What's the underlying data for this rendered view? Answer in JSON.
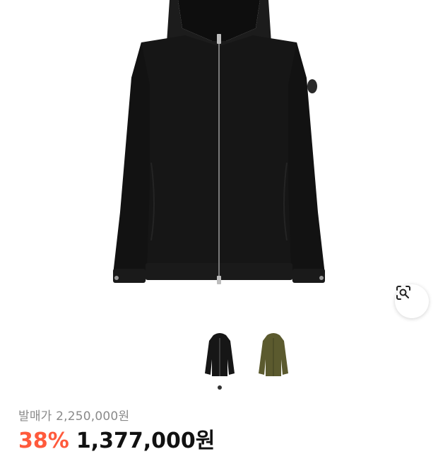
{
  "product": {
    "image_alt": "black hooded zip-up jacket",
    "variants": [
      {
        "name": "black",
        "color": "#161616"
      },
      {
        "name": "khaki",
        "color": "#5b5a2e"
      }
    ],
    "selected_variant_index": 0
  },
  "price": {
    "original_label": "발매가 2,250,000원",
    "discount": "38%",
    "sale": "1,377,000원"
  },
  "colors": {
    "discount": "#ff5a3c",
    "jacket_black": "#161616",
    "jacket_khaki": "#5b5a2e"
  },
  "icons": {
    "lens": "lens-search-icon"
  }
}
